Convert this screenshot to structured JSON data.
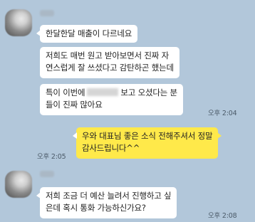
{
  "colors": {
    "background": "#b2c7da",
    "incoming_bubble": "#ffffff",
    "outgoing_bubble": "#ffe94a"
  },
  "messages": [
    {
      "text": "한달한달 매출이 다르네요"
    },
    {
      "line1": "저희도 매번 원고 받아보면서 진짜 자",
      "line2": "연스럽게 잘 쓰셨다고 감탄하곤 했는데"
    },
    {
      "line1_a": "특이 이번에",
      "line1_b": "보고 오셨다는 분",
      "line2": "들이 진짜 많아요",
      "time": "오후 2:04"
    },
    {
      "line1": "우와 대표님 좋은 소식 전해주셔서 정말",
      "line2": "감사드립니다^^",
      "time": "오후 2:05"
    },
    {
      "line1": "저희 조금 더 예산 늘려서 진행하고 싶",
      "line2": "은데 혹시 통화 가능하신가요?",
      "time": "오후 2:08"
    }
  ]
}
